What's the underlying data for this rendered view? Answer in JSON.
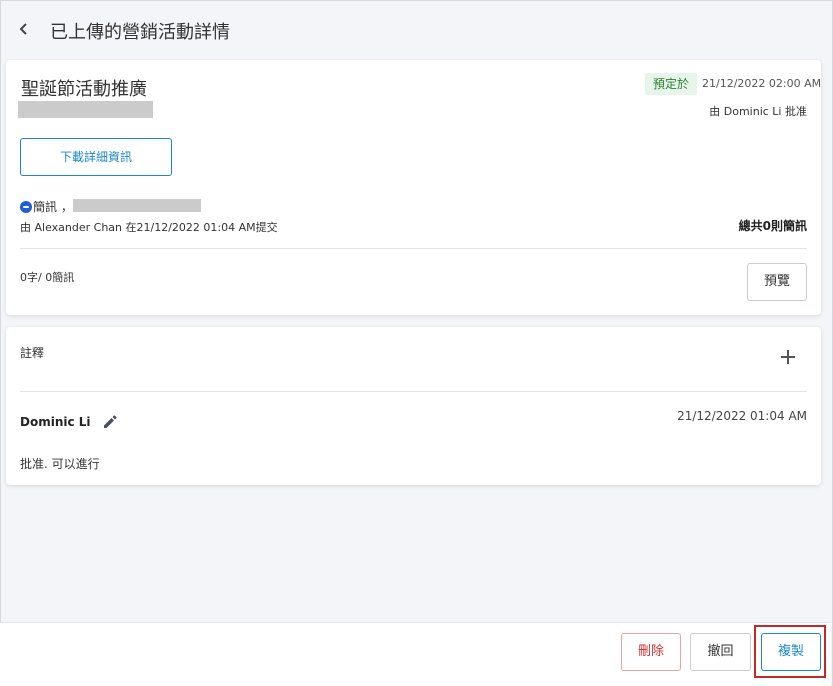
{
  "header": {
    "title": "已上傳的營銷活動詳情"
  },
  "campaign": {
    "name": "聖誕節活動推廣",
    "status_badge": "預定於",
    "scheduled_time": "21/12/2022 02:00 AM",
    "approved_by": "由 Dominic Li 批准",
    "download_label": "下載詳細資訊",
    "channel_label": "簡訊 ，",
    "submitted_by": "由 Alexander Chan 在21/12/2022 01:04 AM提交",
    "total_messages": "總共0則簡訊",
    "char_count": "0字/ 0簡訊",
    "preview_label": "預覽"
  },
  "notes": {
    "title": "註釋",
    "items": [
      {
        "author": "Dominic Li",
        "time": "21/12/2022 01:04 AM",
        "text": "批准. 可以進行"
      }
    ]
  },
  "footer": {
    "delete_label": "刪除",
    "withdraw_label": "撤回",
    "copy_label": "複製"
  },
  "colors": {
    "accent": "#1e88c7",
    "danger": "#d32f2f",
    "success_bg": "#e6f4ea",
    "highlight": "#c62828"
  }
}
